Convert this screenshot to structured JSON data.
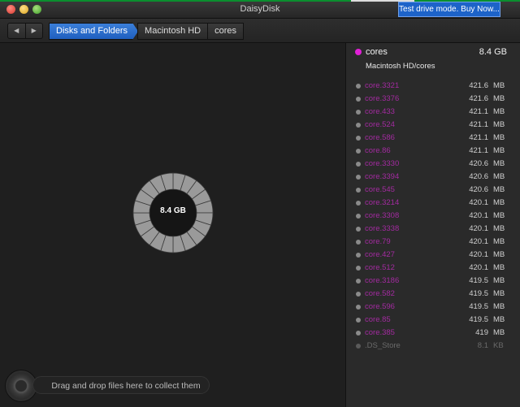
{
  "window": {
    "title": "DaisyDisk"
  },
  "promo": {
    "label": "Test drive mode. Buy Now..."
  },
  "nav": {
    "back_icon": "◀",
    "forward_icon": "▶"
  },
  "breadcrumbs": [
    "Disks and Folders",
    "Macintosh HD",
    "cores"
  ],
  "chart": {
    "center_label": "8.4 GB",
    "segments": 20
  },
  "drop_zone": {
    "label": "Drag and drop files here to collect them"
  },
  "selection": {
    "name": "cores",
    "size": "8.4  GB",
    "path": "Macintosh HD/cores",
    "color": "#e020d6"
  },
  "items": [
    {
      "name": "core.3321",
      "size": "421.6",
      "unit": "MB"
    },
    {
      "name": "core.3376",
      "size": "421.6",
      "unit": "MB"
    },
    {
      "name": "core.433",
      "size": "421.1",
      "unit": "MB"
    },
    {
      "name": "core.524",
      "size": "421.1",
      "unit": "MB"
    },
    {
      "name": "core.586",
      "size": "421.1",
      "unit": "MB"
    },
    {
      "name": "core.86",
      "size": "421.1",
      "unit": "MB"
    },
    {
      "name": "core.3330",
      "size": "420.6",
      "unit": "MB"
    },
    {
      "name": "core.3394",
      "size": "420.6",
      "unit": "MB"
    },
    {
      "name": "core.545",
      "size": "420.6",
      "unit": "MB"
    },
    {
      "name": "core.3214",
      "size": "420.1",
      "unit": "MB"
    },
    {
      "name": "core.3308",
      "size": "420.1",
      "unit": "MB"
    },
    {
      "name": "core.3338",
      "size": "420.1",
      "unit": "MB"
    },
    {
      "name": "core.79",
      "size": "420.1",
      "unit": "MB"
    },
    {
      "name": "core.427",
      "size": "420.1",
      "unit": "MB"
    },
    {
      "name": "core.512",
      "size": "420.1",
      "unit": "MB"
    },
    {
      "name": "core.3186",
      "size": "419.5",
      "unit": "MB"
    },
    {
      "name": "core.582",
      "size": "419.5",
      "unit": "MB"
    },
    {
      "name": "core.596",
      "size": "419.5",
      "unit": "MB"
    },
    {
      "name": "core.85",
      "size": "419.5",
      "unit": "MB"
    },
    {
      "name": "core.385",
      "size": "419",
      "unit": "MB"
    },
    {
      "name": ".DS_Store",
      "size": "8.1",
      "unit": "KB",
      "dim": true
    }
  ]
}
